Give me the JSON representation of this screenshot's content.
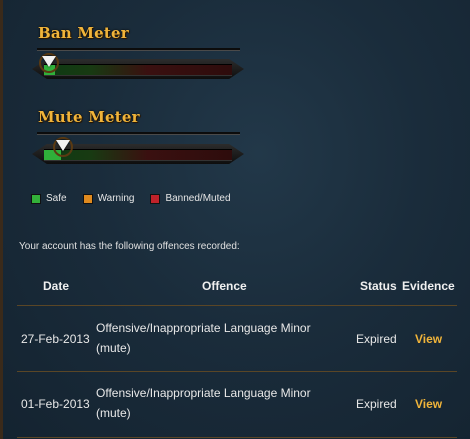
{
  "ban_meter": {
    "title": "Ban Meter",
    "level": 0.06
  },
  "mute_meter": {
    "title": "Mute Meter",
    "level": 0.09
  },
  "legend": [
    {
      "label": "Safe",
      "color": "#33b13a"
    },
    {
      "label": "Warning",
      "color": "#e08a1e"
    },
    {
      "label": "Banned/Muted",
      "color": "#c0222a"
    }
  ],
  "intro_text": "Your account has the following offences recorded:",
  "table": {
    "headers": {
      "date": "Date",
      "offence": "Offence",
      "status": "Status",
      "evidence": "Evidence"
    },
    "rows": [
      {
        "date": "27-Feb-2013",
        "offence_line1": "Offensive/Inappropriate Language Minor",
        "offence_line2": "(mute)",
        "status": "Expired",
        "evidence": "View"
      },
      {
        "date": "01-Feb-2013",
        "offence_line1": "Offensive/Inappropriate Language Minor",
        "offence_line2": "(mute)",
        "status": "Expired",
        "evidence": "View"
      }
    ]
  },
  "colors": {
    "accent": "#f0b43a",
    "background": "#1a2c3b"
  }
}
